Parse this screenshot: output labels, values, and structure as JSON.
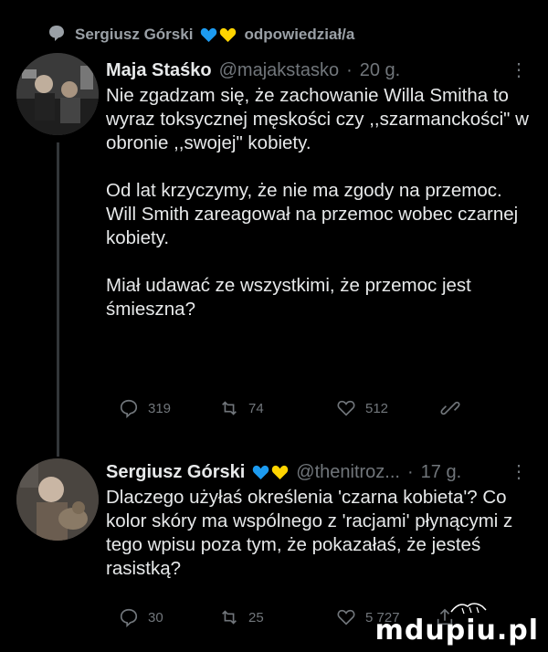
{
  "social_context": {
    "name": "Sergiusz Górski",
    "action": "odpowiedział/a"
  },
  "colors": {
    "heart_blue": "#1d9bf0",
    "heart_yellow": "#ffd400",
    "muted": "#71767b"
  },
  "tweets": [
    {
      "name": "Maja Staśko",
      "handle": "@majakstasko",
      "dot": "·",
      "time": "20 g.",
      "more": "⋮",
      "paragraphs": [
        "Nie zgadzam się, że zachowanie Willa Smitha to wyraz toksycznej męskości czy ,,szarmanckości\" w obronie ,,swojej\" kobiety.",
        "Od lat krzyczymy, że nie ma zgody na przemoc. Will Smith zareagował na przemoc wobec czarnej kobiety.",
        "Miał udawać ze wszystkimi, że przemoc jest śmieszna?"
      ],
      "actions": {
        "reply_count": "319",
        "retweet_count": "74",
        "like_count": "512"
      }
    },
    {
      "name": "Sergiusz Górski",
      "handle": "@thenitroz...",
      "dot": "·",
      "time": "17 g.",
      "more": "⋮",
      "paragraphs": [
        "Dlaczego użyłaś określenia 'czarna kobieta'? Co kolor skóry ma wspólnego z 'racjami' płynącymi z tego wpisu poza tym, że pokazałaś, że jesteś rasistką?"
      ],
      "actions": {
        "reply_count": "30",
        "retweet_count": "25",
        "like_count": "5 727"
      }
    }
  ],
  "watermark": "mdupiu.pl"
}
